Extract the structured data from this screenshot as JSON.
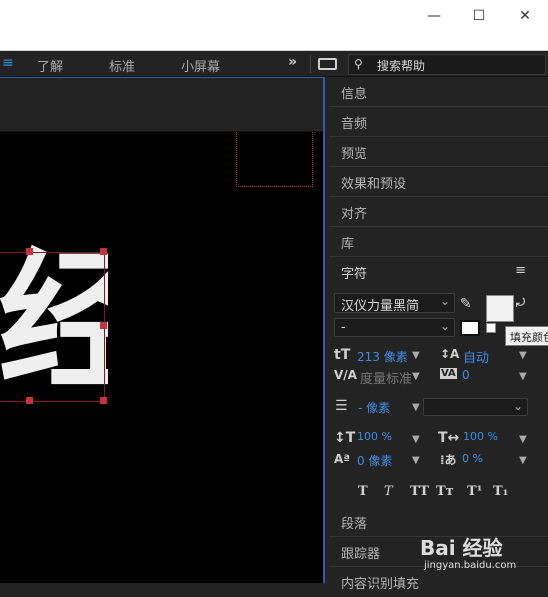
{
  "window": {
    "minimize": "—",
    "maximize": "☐",
    "close": "✕"
  },
  "workspace": {
    "menu_icon": "≡",
    "items": [
      "了解",
      "标准",
      "小屏幕"
    ],
    "more": "»",
    "search_placeholder": "搜索帮助"
  },
  "panels": {
    "items": [
      "信息",
      "音频",
      "预览",
      "效果和预设",
      "对齐",
      "库",
      "字符"
    ],
    "bottom": [
      "段落",
      "跟踪器",
      "内容识别填充"
    ]
  },
  "character": {
    "font_family": "汉仪力量黑简",
    "font_style": "-",
    "font_size": "213 像素",
    "leading": "自动",
    "kerning": "度量标准",
    "tracking": "0",
    "stroke_width": "- 像素",
    "vertical_scale": "100 %",
    "horizontal_scale": "100 %",
    "baseline_shift": "0 像素",
    "tsume": "0 %",
    "tooltip": "填充颜色",
    "fill_color": "#f2f2f2",
    "style_buttons": [
      "T",
      "T",
      "TT",
      "Tт",
      "T¹",
      "T₁"
    ]
  },
  "composition": {
    "glyph": "经"
  },
  "watermark": {
    "logo": "Bai 经验",
    "url": "jingyan.baidu.com"
  }
}
